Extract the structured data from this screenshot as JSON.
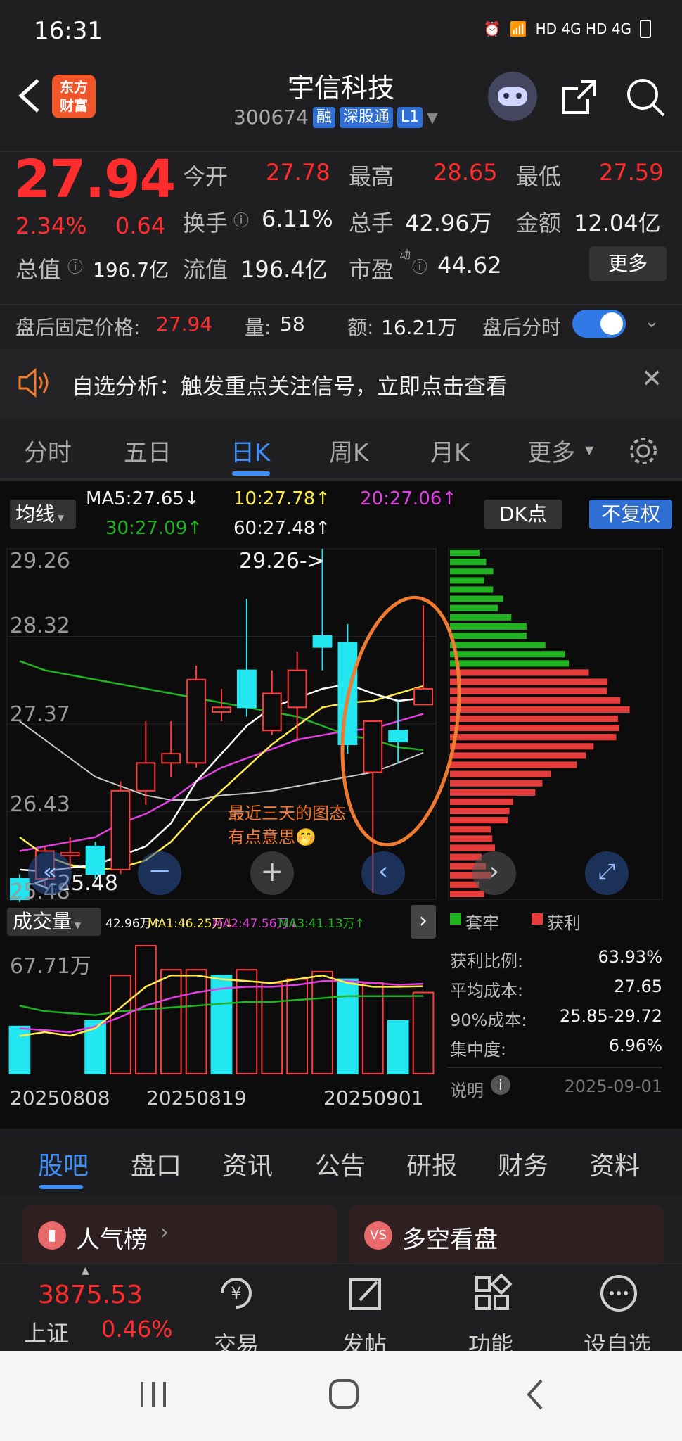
{
  "status_bar": {
    "time": "16:31",
    "network": "HD 4G HD 4G"
  },
  "header": {
    "title": "宇信科技",
    "code": "300674",
    "tag_rong": "融",
    "tag_connect": "深股通",
    "tag_level": "L1",
    "logo_text_1": "东方",
    "logo_text_2": "财富"
  },
  "quote": {
    "price": "27.94",
    "change_pct": "2.34%",
    "change": "0.64",
    "open_label": "今开",
    "open": "27.78",
    "high_label": "最高",
    "high": "28.65",
    "low_label": "最低",
    "low": "27.59",
    "turnover_label": "换手",
    "turnover": "6.11%",
    "volume_label": "总手",
    "volume": "42.96万",
    "amount_label": "金额",
    "amount": "12.04亿",
    "mktcap_label": "总值",
    "mktcap": "196.7亿",
    "float_label": "流值",
    "float": "196.4亿",
    "pe_label": "市盈",
    "pe_sup": "动",
    "pe": "44.62",
    "more_btn": "更多"
  },
  "after_hours": {
    "price_label": "盘后固定价格:",
    "price": "27.94",
    "vol_label": "量:",
    "vol": "58",
    "amt_label": "额:",
    "amt": "16.21万",
    "toggle_label": "盘后分时"
  },
  "banner": {
    "text": "自选分析：触发重点关注信号，立即点击查看"
  },
  "chart_tabs": [
    "分时",
    "五日",
    "日K",
    "周K",
    "月K",
    "更多"
  ],
  "active_tab": "日K",
  "ma_bar": {
    "selector": "均线",
    "ma5": "MA5:27.65↓",
    "ma10": "10:27.78↑",
    "ma20": "20:27.06↑",
    "ma30": "30:27.09↑",
    "ma60": "60:27.48↑",
    "dk_btn": "DK点",
    "adjust_btn": "不复权"
  },
  "price_axis": [
    "29.26",
    "28.32",
    "27.37",
    "26.43",
    "25.48"
  ],
  "chart_marks": {
    "high_marker": "29.26->",
    "low_marker": "<-25.48",
    "annotation_1": "最近三天的图态",
    "annotation_2": "有点意思🤭"
  },
  "volume_bar": {
    "selector": "成交量",
    "vol": "42.96万↑",
    "ma1": "MA1:46.25万↓",
    "ma2": "MA2:47.56万↓",
    "ma3": "MA3:41.13万↑",
    "axis_max": "67.71万"
  },
  "dates": [
    "20250808",
    "20250819",
    "20250901"
  ],
  "chip_panel": {
    "legend_locked": "套牢",
    "legend_profit": "获利",
    "rows": [
      {
        "label": "获利比例:",
        "value": "63.93%"
      },
      {
        "label": "平均成本:",
        "value": "27.65"
      },
      {
        "label": "90%成本:",
        "value": "25.85-29.72"
      },
      {
        "label": "集中度:",
        "value": "6.96%"
      }
    ],
    "note_label": "说明",
    "date": "2025-09-01"
  },
  "bottom_tabs": [
    "股吧",
    "盘口",
    "资讯",
    "公告",
    "研报",
    "财务",
    "资料"
  ],
  "cards": {
    "left": "人气榜",
    "right": "多空看盘"
  },
  "index": {
    "value": "3875.53",
    "name": "上证",
    "pct": "0.46%"
  },
  "bottom_nav": [
    "交易",
    "发帖",
    "功能",
    "设自选"
  ],
  "chart_data": {
    "type": "candlestick",
    "ylim": [
      25.48,
      29.26
    ],
    "candles": [
      {
        "o": 25.48,
        "c": 25.7,
        "h": 25.75,
        "l": 25.45,
        "dir": "down"
      },
      {
        "o": 25.7,
        "c": 26.0,
        "h": 26.05,
        "l": 25.6,
        "dir": "up"
      },
      {
        "o": 25.95,
        "c": 25.98,
        "h": 26.15,
        "l": 25.8,
        "dir": "up"
      },
      {
        "o": 26.05,
        "c": 25.75,
        "h": 26.1,
        "l": 25.7,
        "dir": "down"
      },
      {
        "o": 25.8,
        "c": 26.65,
        "h": 26.75,
        "l": 25.75,
        "dir": "up"
      },
      {
        "o": 26.65,
        "c": 26.95,
        "h": 27.4,
        "l": 26.5,
        "dir": "up"
      },
      {
        "o": 26.95,
        "c": 27.05,
        "h": 27.4,
        "l": 26.8,
        "dir": "up"
      },
      {
        "o": 26.95,
        "c": 27.85,
        "h": 28.0,
        "l": 26.9,
        "dir": "up"
      },
      {
        "o": 27.5,
        "c": 27.55,
        "h": 27.75,
        "l": 27.4,
        "dir": "up"
      },
      {
        "o": 27.95,
        "c": 27.55,
        "h": 28.72,
        "l": 27.45,
        "dir": "down"
      },
      {
        "o": 27.3,
        "c": 27.7,
        "h": 27.95,
        "l": 27.25,
        "dir": "up"
      },
      {
        "o": 27.55,
        "c": 27.95,
        "h": 28.15,
        "l": 27.2,
        "dir": "up"
      },
      {
        "o": 28.32,
        "c": 28.2,
        "h": 29.26,
        "l": 27.95,
        "dir": "down"
      },
      {
        "o": 28.25,
        "c": 27.15,
        "h": 28.45,
        "l": 27.05,
        "dir": "down"
      },
      {
        "o": 26.85,
        "c": 27.4,
        "h": 27.4,
        "l": 25.55,
        "dir": "up"
      },
      {
        "o": 27.3,
        "c": 27.18,
        "h": 27.62,
        "l": 26.95,
        "dir": "down"
      },
      {
        "o": 27.58,
        "c": 27.75,
        "h": 28.65,
        "l": 27.58,
        "dir": "up"
      }
    ],
    "ma5": [
      25.8,
      25.78,
      25.82,
      25.85,
      25.95,
      26.05,
      26.3,
      26.75,
      27.05,
      27.35,
      27.55,
      27.65,
      27.75,
      27.8,
      27.7,
      27.62,
      27.65
    ],
    "ma10": [
      26.15,
      25.95,
      25.85,
      25.8,
      25.82,
      25.9,
      26.1,
      26.4,
      26.65,
      26.9,
      27.15,
      27.35,
      27.55,
      27.6,
      27.62,
      27.7,
      27.78
    ],
    "ma20": [
      26.0,
      26.05,
      26.1,
      26.15,
      26.3,
      26.4,
      26.55,
      26.75,
      26.9,
      27.0,
      27.1,
      27.2,
      27.25,
      27.3,
      27.32,
      27.4,
      27.48
    ],
    "ma30": [
      28.05,
      27.95,
      27.9,
      27.85,
      27.8,
      27.75,
      27.7,
      27.65,
      27.6,
      27.55,
      27.5,
      27.45,
      27.35,
      27.25,
      27.2,
      27.12,
      27.09
    ],
    "ma60": [
      27.4,
      27.2,
      27.0,
      26.8,
      26.7,
      26.6,
      26.55,
      26.55,
      26.6,
      26.62,
      26.65,
      26.7,
      26.75,
      26.8,
      26.85,
      26.95,
      27.06
    ],
    "volumes": [
      25,
      0,
      0,
      28,
      52,
      67.71,
      55,
      55,
      52,
      55,
      48,
      50,
      54,
      50,
      48,
      28,
      42.96
    ],
    "vol_dir": [
      "down",
      "up",
      "up",
      "down",
      "up",
      "up",
      "up",
      "up",
      "down",
      "up",
      "up",
      "up",
      "up",
      "down",
      "up",
      "down",
      "up"
    ],
    "chip_profit_share": 0.6393
  }
}
